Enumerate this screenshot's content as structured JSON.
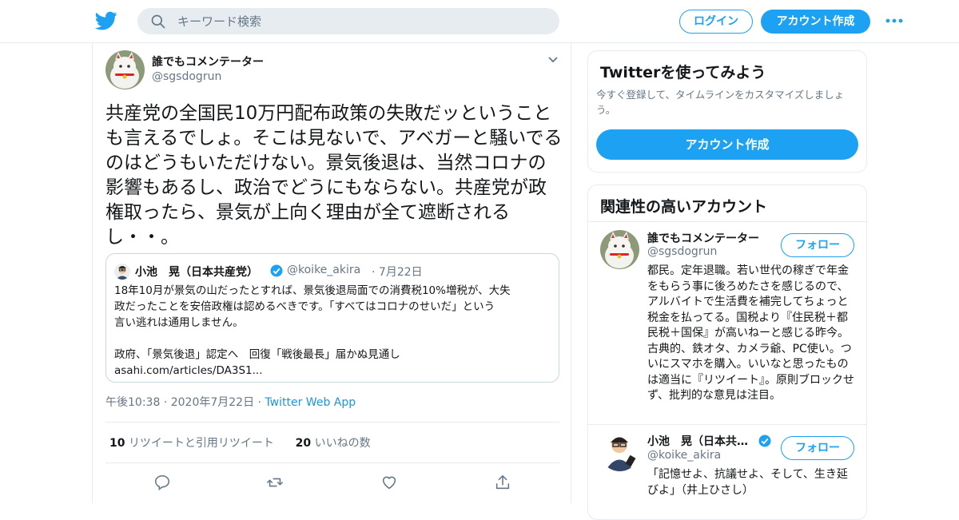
{
  "header": {
    "search_placeholder": "キーワード検索",
    "login_label": "ログイン",
    "signup_label": "アカウント作成"
  },
  "tweet": {
    "author_name": "誰でもコメンテーター",
    "author_handle": "@sgsdogrun",
    "text": "共産党の全国民10万円配布政策の失敗だッということも言えるでしょ。そこは見ないで、アベガーと騒いでるのはどうもいただけない。景気後退は、当然コロナの影響もあるし、政治でどうにもならない。共産党が政権取ったら、景気が上向く理由が全て遮断されるし・・。",
    "quote": {
      "name": "小池　晃（日本共産党）",
      "handle": "@koike_akira",
      "date": "7月22日",
      "lines": [
        "18年10月が景気の山だったとすれば、景気後退局面での消費税10%増税が、大失",
        "政だったことを安倍政権は認めるべきです。「すべてはコロナのせいだ」という",
        "言い逃れは通用しません。",
        "",
        "政府、「景気後退」認定へ　回復「戦後最長」届かぬ見通し",
        "asahi.com/articles/DA3S1..."
      ]
    },
    "time": "午後10:38",
    "date": "2020年7月22日",
    "app": "Twitter Web App",
    "retweets_count": "10",
    "retweets_label": "リツイートと引用リツイート",
    "likes_count": "20",
    "likes_label": "いいねの数"
  },
  "sidebar": {
    "promo_title": "Twitterを使ってみよう",
    "promo_desc": "今すぐ登録して、タイムラインをカスタマイズしましょう。",
    "promo_button": "アカウント作成",
    "related_title": "関連性の高いアカウント",
    "accounts": [
      {
        "name": "誰でもコメンテーター",
        "handle": "@sgsdogrun",
        "follow_label": "フォロー",
        "bio": "都民。定年退職。若い世代の稼ぎで年金をもらう事に後ろめたさを感じるので、アルバイトで生活費を補完してちょっと税金を払ってる。国税より『住民税＋都民税＋国保』が高いねーと感じる昨今。古典的、鉄オタ、カメラ爺、PC使い。ついにスマホを購入。いいなと思ったものは適当に『リツイート』。原則ブロックせず、批判的な意見は注目。"
      },
      {
        "name": "小池　晃（日本共…",
        "handle": "@koike_akira",
        "follow_label": "フォロー",
        "bio": "「記憶せよ、抗議せよ、そして、生き延びよ」（井上ひさし）"
      }
    ]
  },
  "colors": {
    "accent": "#1da1f2",
    "muted": "#657786",
    "border": "#e6ecf0"
  }
}
